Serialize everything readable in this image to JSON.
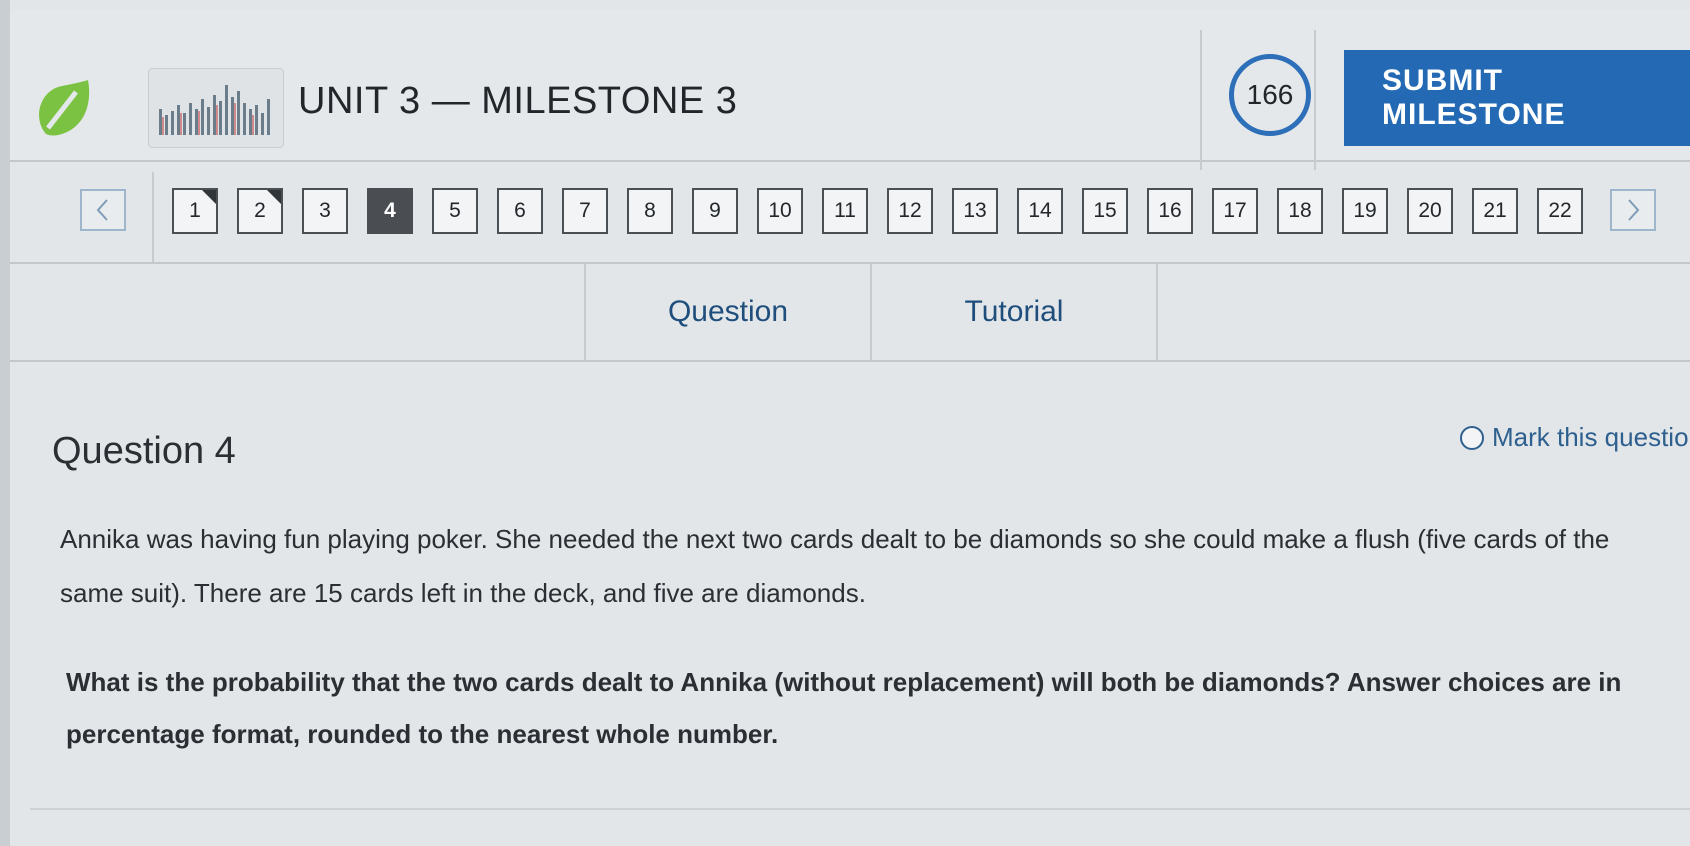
{
  "header": {
    "title": "UNIT 3 — MILESTONE 3",
    "counter": "166",
    "submit_label": "SUBMIT MILESTONE",
    "logo_icon": "sophia-leaf-logo",
    "thumbnail_icon": "bar-chart-thumbnail"
  },
  "nav": {
    "prev_icon": "chevron-left-icon",
    "next_icon": "chevron-right-icon",
    "current": 4,
    "questions": [
      {
        "label": "1",
        "state": "done"
      },
      {
        "label": "2",
        "state": "done"
      },
      {
        "label": "3",
        "state": "normal"
      },
      {
        "label": "4",
        "state": "current"
      },
      {
        "label": "5",
        "state": "normal"
      },
      {
        "label": "6",
        "state": "normal"
      },
      {
        "label": "7",
        "state": "normal"
      },
      {
        "label": "8",
        "state": "normal"
      },
      {
        "label": "9",
        "state": "normal"
      },
      {
        "label": "10",
        "state": "normal"
      },
      {
        "label": "11",
        "state": "normal"
      },
      {
        "label": "12",
        "state": "normal"
      },
      {
        "label": "13",
        "state": "normal"
      },
      {
        "label": "14",
        "state": "normal"
      },
      {
        "label": "15",
        "state": "normal"
      },
      {
        "label": "16",
        "state": "normal"
      },
      {
        "label": "17",
        "state": "normal"
      },
      {
        "label": "18",
        "state": "normal"
      },
      {
        "label": "19",
        "state": "normal"
      },
      {
        "label": "20",
        "state": "normal"
      },
      {
        "label": "21",
        "state": "normal"
      },
      {
        "label": "22",
        "state": "normal"
      }
    ]
  },
  "tabs": {
    "question": "Question",
    "tutorial": "Tutorial"
  },
  "question": {
    "title": "Question 4",
    "mark_label": "Mark this questio",
    "stem": "Annika was having fun playing poker. She needed the next two cards dealt to be diamonds so she could make a flush (five cards of the same suit). There are 15 cards left in the deck, and five are diamonds.",
    "prompt": "What is the probability that the two cards dealt to Annika (without replacement) will both be diamonds? Answer choices are in percentage format, rounded to the nearest whole number."
  },
  "colors": {
    "accent": "#2369b3",
    "counter_ring": "#2d6fb8",
    "current_question": "#4a4e53",
    "logo_green": "#7cc242",
    "tab_text": "#1f4e7c"
  }
}
